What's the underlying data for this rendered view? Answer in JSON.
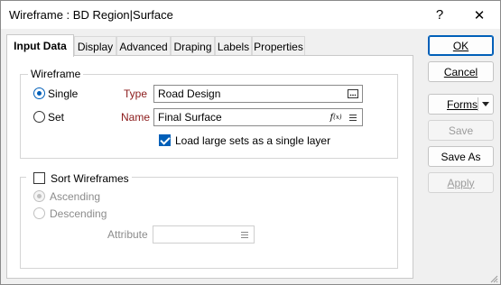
{
  "window": {
    "title": "Wireframe : BD Region|Surface",
    "help_glyph": "?",
    "close_glyph": "✕"
  },
  "tabs": [
    "Input Data",
    "Display",
    "Advanced",
    "Draping",
    "Labels",
    "Properties"
  ],
  "wireframe_group": {
    "legend": "Wireframe",
    "single_label": "Single",
    "set_label": "Set",
    "selected_mode": "Single",
    "type_label": "Type",
    "type_value": "Road Design",
    "name_label": "Name",
    "name_value": "Final Surface",
    "load_large_sets_label": "Load large sets as a single layer",
    "load_large_sets_checked": true
  },
  "sort_group": {
    "label": "Sort Wireframes",
    "checked": false,
    "ascending_label": "Ascending",
    "descending_label": "Descending",
    "selected_order": "Ascending",
    "attribute_label": "Attribute",
    "attribute_value": ""
  },
  "buttons": {
    "ok": "OK",
    "cancel": "Cancel",
    "forms": "Forms",
    "save": "Save",
    "save_as": "Save As",
    "apply": "Apply"
  },
  "colors": {
    "accent": "#005fb8",
    "field_label_red": "#8b1a1a",
    "disabled_text": "#8c8c8c"
  }
}
